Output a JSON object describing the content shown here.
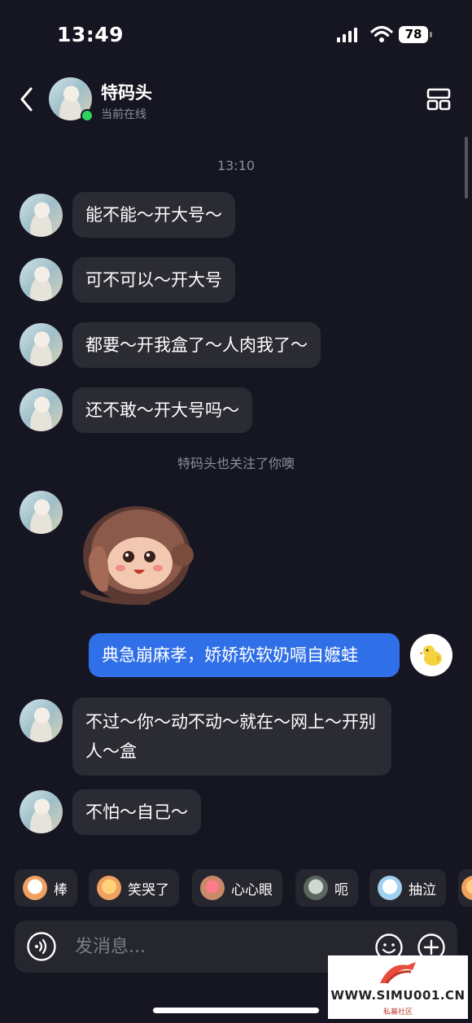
{
  "status_bar": {
    "time": "13:49",
    "battery": "78"
  },
  "header": {
    "name": "特码头",
    "status": "当前在线"
  },
  "timestamp": "13:10",
  "messages": [
    {
      "text": "能不能～开大号～"
    },
    {
      "text": "可不可以～开大号"
    },
    {
      "text": "都要～开我盒了～人肉我了～"
    },
    {
      "text": "还不敢～开大号吗～"
    }
  ],
  "system_notice": "特码头也关注了你噢",
  "my_message": "典急崩麻孝，娇娇软软奶嗝自嬷蛙",
  "later_messages": [
    {
      "text": "不过～你～动不动～就在～网上～开别人～盒"
    },
    {
      "text": "不怕～自己～"
    }
  ],
  "quick_reactions": [
    {
      "label": "棒"
    },
    {
      "label": "笑哭了"
    },
    {
      "label": "心心眼"
    },
    {
      "label": "呃"
    },
    {
      "label": "抽泣"
    }
  ],
  "input": {
    "placeholder": "发消息..."
  },
  "watermark": {
    "text": "WWW.SIMU001.CN",
    "subtext": "私募社区"
  },
  "colors": {
    "background": "#161622",
    "bubble": "#2b2b33",
    "my_bubble": "#2f6fe8",
    "online": "#2fd15a"
  },
  "icons": [
    "back-chevron-icon",
    "layout-grid-icon",
    "voice-icon",
    "emoji-icon",
    "plus-icon"
  ]
}
